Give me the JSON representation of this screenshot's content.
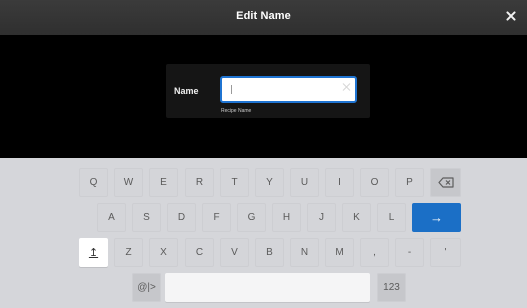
{
  "dialog": {
    "title": "Edit Name",
    "close_icon": "close-icon"
  },
  "form": {
    "name_label": "Name",
    "input_value": "",
    "input_hint": "Recipe Name"
  },
  "keyboard": {
    "row1": [
      "Q",
      "W",
      "E",
      "R",
      "T",
      "Y",
      "U",
      "I",
      "O",
      "P"
    ],
    "backspace_icon": "backspace-icon",
    "row2": [
      "A",
      "S",
      "D",
      "F",
      "G",
      "H",
      "J",
      "K",
      "L"
    ],
    "enter_icon": "→",
    "shift_icon": "↥",
    "row3": [
      "Z",
      "X",
      "C",
      "V",
      "B",
      "N",
      "M",
      ",",
      "-",
      "'"
    ],
    "symbols_label": "@|>",
    "numbers_label": "123"
  },
  "colors": {
    "accent": "#1b6fc6",
    "titlebar": "#353535",
    "keyboard_bg": "#d5d6da"
  }
}
